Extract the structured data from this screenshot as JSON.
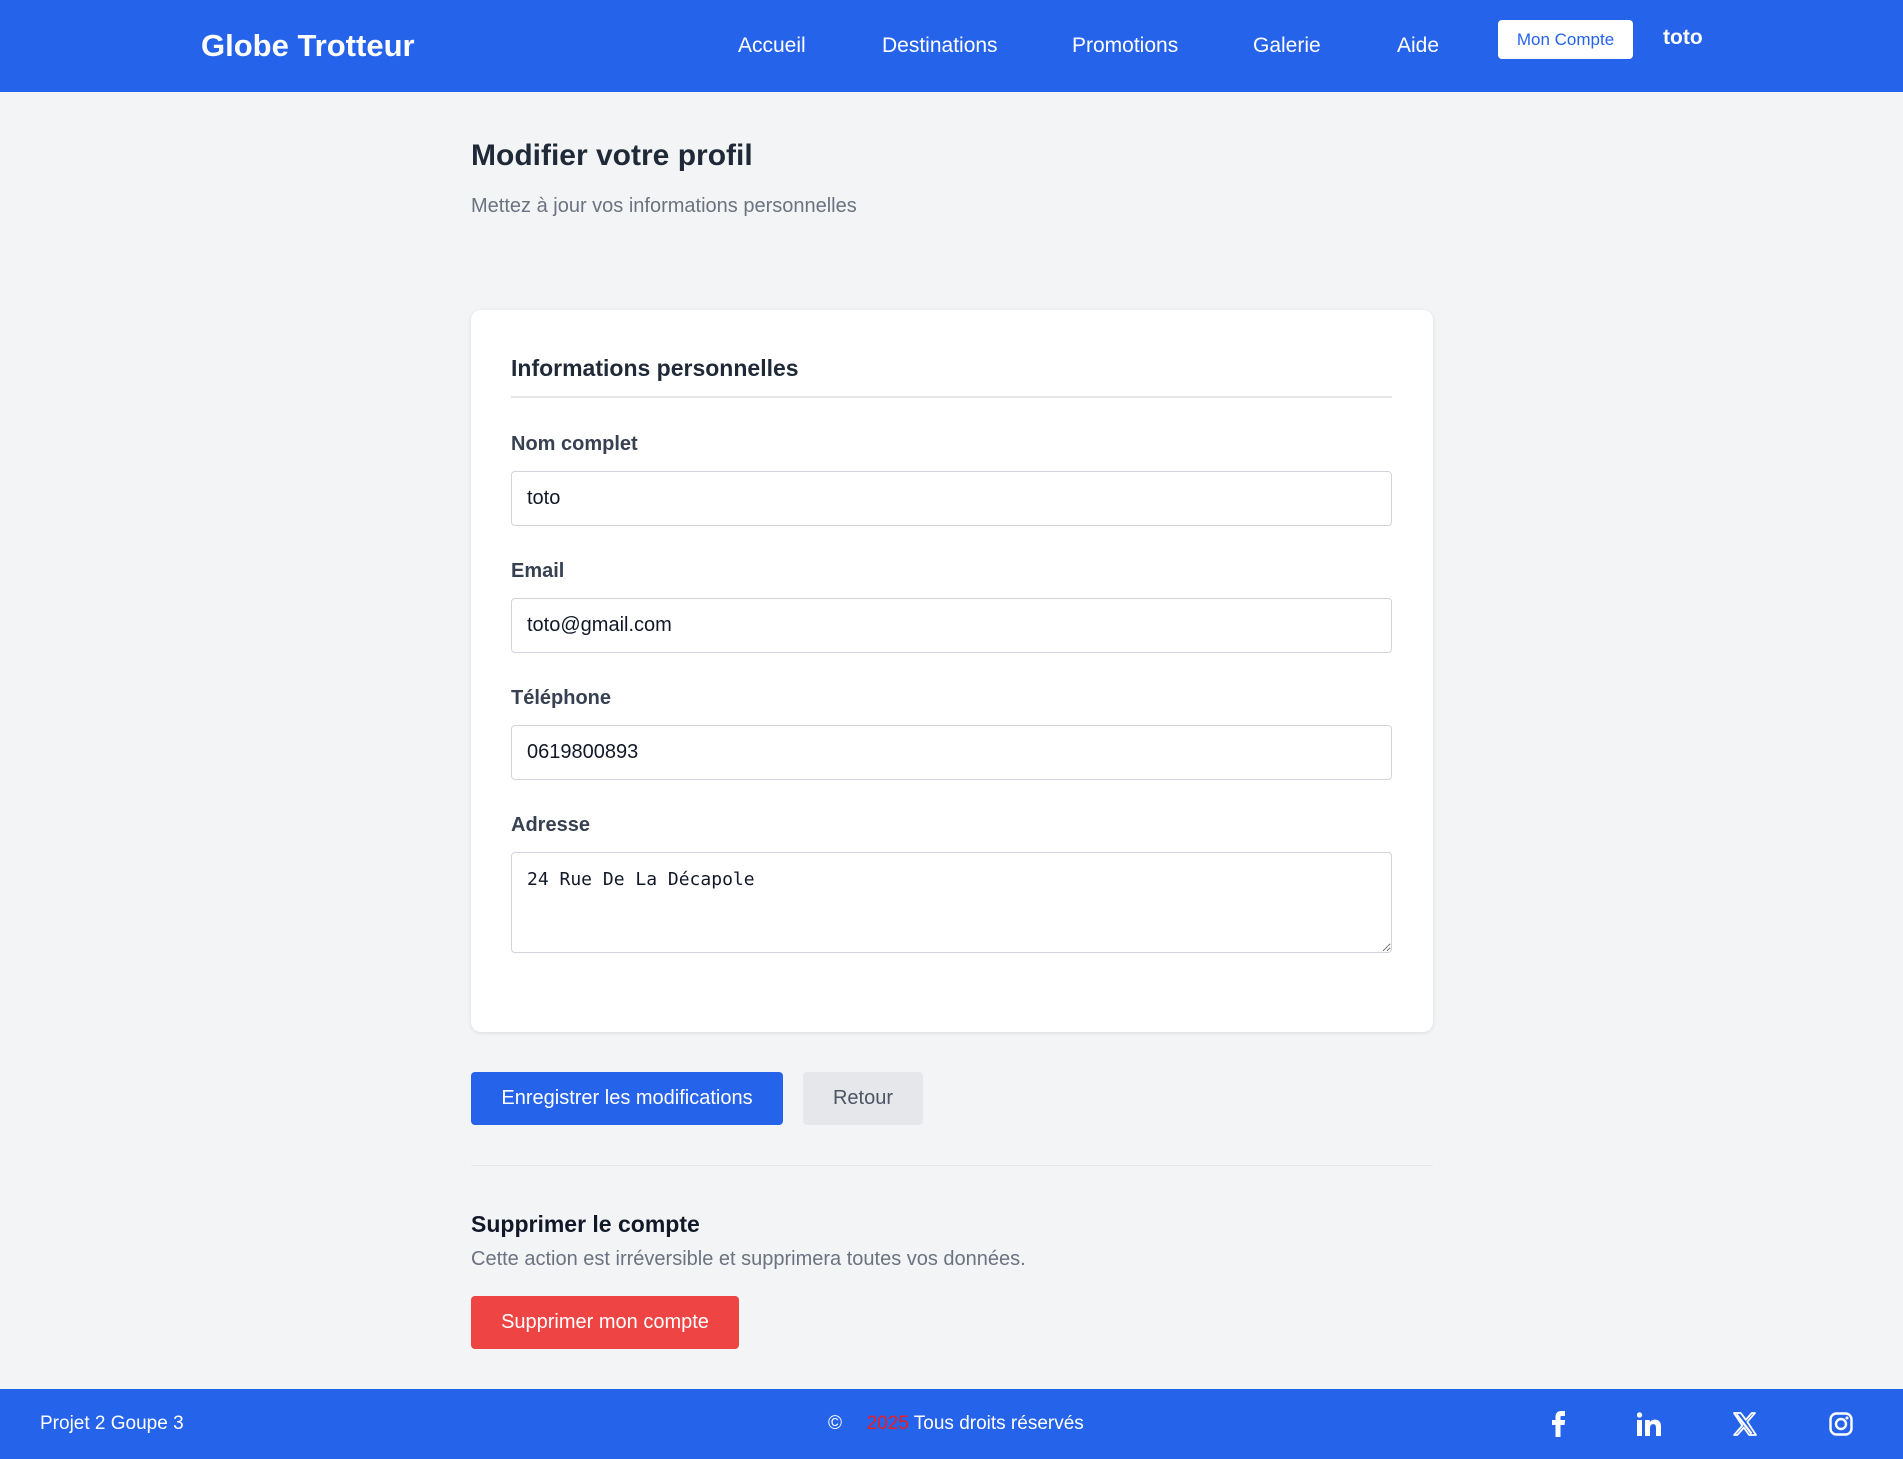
{
  "header": {
    "brand": "Globe Trotteur",
    "nav": [
      "Accueil",
      "Destinations",
      "Promotions",
      "Galerie",
      "Aide"
    ],
    "account_button": "Mon Compte",
    "username": "toto"
  },
  "page": {
    "title": "Modifier votre profil",
    "subtitle": "Mettez à jour vos informations personnelles"
  },
  "card": {
    "title": "Informations personnelles",
    "fields": [
      {
        "label": "Nom complet",
        "value": "toto"
      },
      {
        "label": "Email",
        "value": "toto@gmail.com"
      },
      {
        "label": "Téléphone",
        "value": "0619800893"
      },
      {
        "label": "Adresse",
        "value": "24 Rue De La Décapole"
      }
    ]
  },
  "actions": {
    "save": "Enregistrer les modifications",
    "back": "Retour"
  },
  "danger": {
    "title": "Supprimer le compte",
    "text": "Cette action est irréversible et supprimera toutes vos données.",
    "button": "Supprimer mon compte"
  },
  "footer": {
    "left": "Projet 2 Goupe 3",
    "copyright_symbol": "©",
    "year": "2025",
    "rights": "Tous droits réservés",
    "year_color": "#ef1c1c",
    "social": [
      "facebook-icon",
      "linkedin-icon",
      "x-icon",
      "instagram-icon"
    ]
  },
  "colors": {
    "primary": "#2563eb",
    "danger": "#ef4444",
    "background": "#f3f4f6"
  }
}
